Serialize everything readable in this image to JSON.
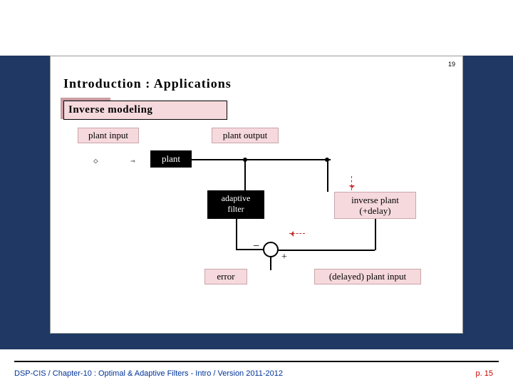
{
  "title": "Optimal & Adaptive Filters - Intro",
  "corner_number": "19",
  "section_heading": "Introduction : Applications",
  "subsection": "Inverse modeling",
  "labels": {
    "plant_input": "plant input",
    "plant_output": "plant output",
    "plant": "plant",
    "adaptive_filter_l1": "adaptive",
    "adaptive_filter_l2": "filter",
    "inverse_plant_l1": "inverse plant",
    "inverse_plant_l2": "(+delay)",
    "error": "error",
    "delayed_input": "(delayed) plant input",
    "minus": "−",
    "plus": "+"
  },
  "footer": {
    "left": "DSP-CIS / Chapter-10 : Optimal & Adaptive Filters - Intro / Version 2011-2012",
    "right": "p. 15"
  }
}
